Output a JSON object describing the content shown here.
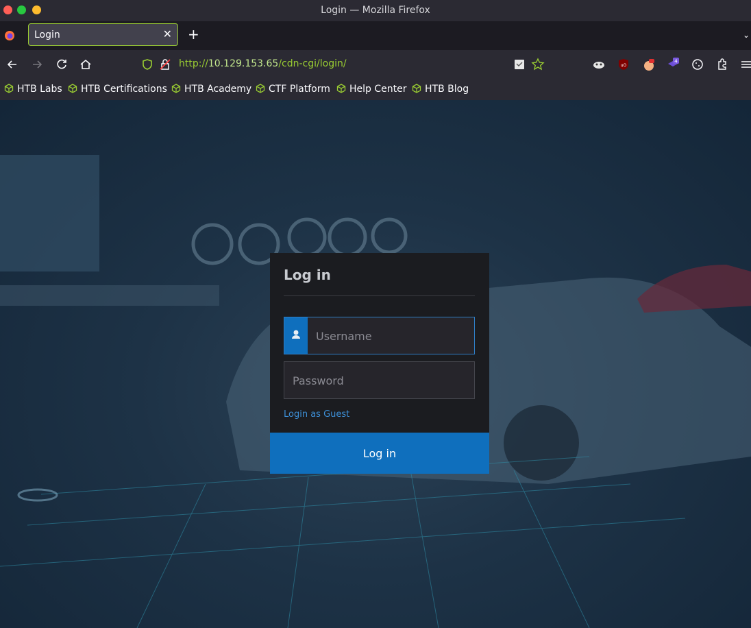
{
  "window": {
    "title": "Login — Mozilla Firefox"
  },
  "tab": {
    "label": "Login",
    "close": "✕",
    "new_tab": "+"
  },
  "address_bar": {
    "scheme": "http://",
    "host": "10.129.153.65",
    "path": "/cdn-cgi/login/"
  },
  "bookmarks": [
    "HTB Labs",
    "HTB Certifications",
    "HTB Academy",
    "CTF Platform",
    "Help Center",
    "HTB Blog"
  ],
  "extensions": {
    "notifications_badge": "4"
  },
  "login": {
    "title": "Log in",
    "username_placeholder": "Username",
    "password_placeholder": "Password",
    "guest_link": "Login as Guest",
    "submit_label": "Log in"
  },
  "colors": {
    "accent": "#0f6fbd",
    "url_green": "#9acd32",
    "panel_bg": "#1b1c20"
  }
}
